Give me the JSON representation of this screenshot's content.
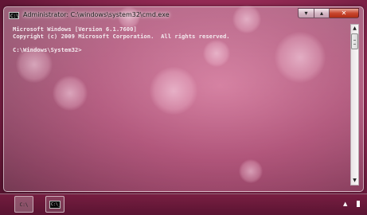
{
  "window": {
    "title": "Administrator: C:\\windows\\system32\\cmd.exe",
    "icon_label": "C:\\",
    "buttons": {
      "minimize": "▾",
      "maximize": "▴",
      "close": "✕"
    }
  },
  "console": {
    "lines": [
      "Microsoft Windows [Version 6.1.7600]",
      "Copyright (c) 2009 Microsoft Corporation.  All rights reserved.",
      "",
      "C:\\Windows\\System32>"
    ],
    "text_color": "#f3e9ee"
  },
  "scrollbar": {
    "up_arrow": "▲",
    "down_arrow": "▼"
  },
  "taskbar": {
    "items": [
      {
        "label": "C:\\"
      },
      {
        "label": "C:\\_"
      }
    ],
    "tray_arrow": "▲"
  },
  "colors": {
    "desktop_base": "#9c2e5a",
    "close_button": "#c8472f"
  }
}
